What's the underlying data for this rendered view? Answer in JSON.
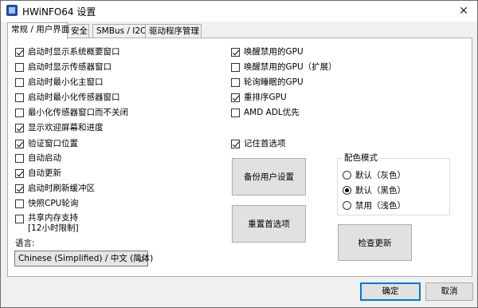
{
  "window": {
    "title": "HWiNFO64 设置",
    "close_glyph": "✕"
  },
  "tabs": [
    {
      "label": "常规 / 用户界面",
      "active": true
    },
    {
      "label": "安全",
      "active": false
    },
    {
      "label": "SMBus / I2C",
      "active": false
    },
    {
      "label": "驱动程序管理",
      "active": false
    }
  ],
  "left_options": [
    {
      "label": "启动时显示系统概要窗口",
      "checked": true
    },
    {
      "label": "启动时显示传感器窗口",
      "checked": false
    },
    {
      "label": "启动时最小化主窗口",
      "checked": false
    },
    {
      "label": "启动时最小化传感器窗口",
      "checked": false
    },
    {
      "label": "最小化传感器窗口而不关闭",
      "checked": false
    },
    {
      "label": "显示欢迎屏幕和进度",
      "checked": true
    },
    {
      "label": "验证窗口位置",
      "checked": true
    },
    {
      "label": "自动启动",
      "checked": false
    },
    {
      "label": "自动更新",
      "checked": true
    },
    {
      "label": "启动时刷新缓冲区",
      "checked": true
    },
    {
      "label": "快照CPU轮询",
      "checked": false
    }
  ],
  "shared_memory": {
    "line1": "共享内存支持",
    "line2": "[12小时限制]",
    "checked": false
  },
  "right_options": [
    {
      "label": "唤醒禁用的GPU",
      "checked": true
    },
    {
      "label": "唤醒禁用的GPU（扩展）",
      "checked": false
    },
    {
      "label": "轮询睡眠的GPU",
      "checked": false
    },
    {
      "label": "重排序GPU",
      "checked": true
    },
    {
      "label": "AMD ADL优先",
      "checked": false
    }
  ],
  "remember_prefs": {
    "label": "记住首选项",
    "checked": true
  },
  "color_mode": {
    "title": "配色模式",
    "options": [
      {
        "label": "默认（灰色）",
        "selected": false
      },
      {
        "label": "默认（黑色）",
        "selected": true
      },
      {
        "label": "禁用（浅色）",
        "selected": false
      }
    ]
  },
  "buttons": {
    "backup": "备份用户设置",
    "reset": "重置首选项",
    "check_update": "检查更新",
    "ok": "确定",
    "cancel": "取消"
  },
  "language": {
    "label": "语言:",
    "value": "Chinese (Simplified) / 中文 (简体)"
  }
}
